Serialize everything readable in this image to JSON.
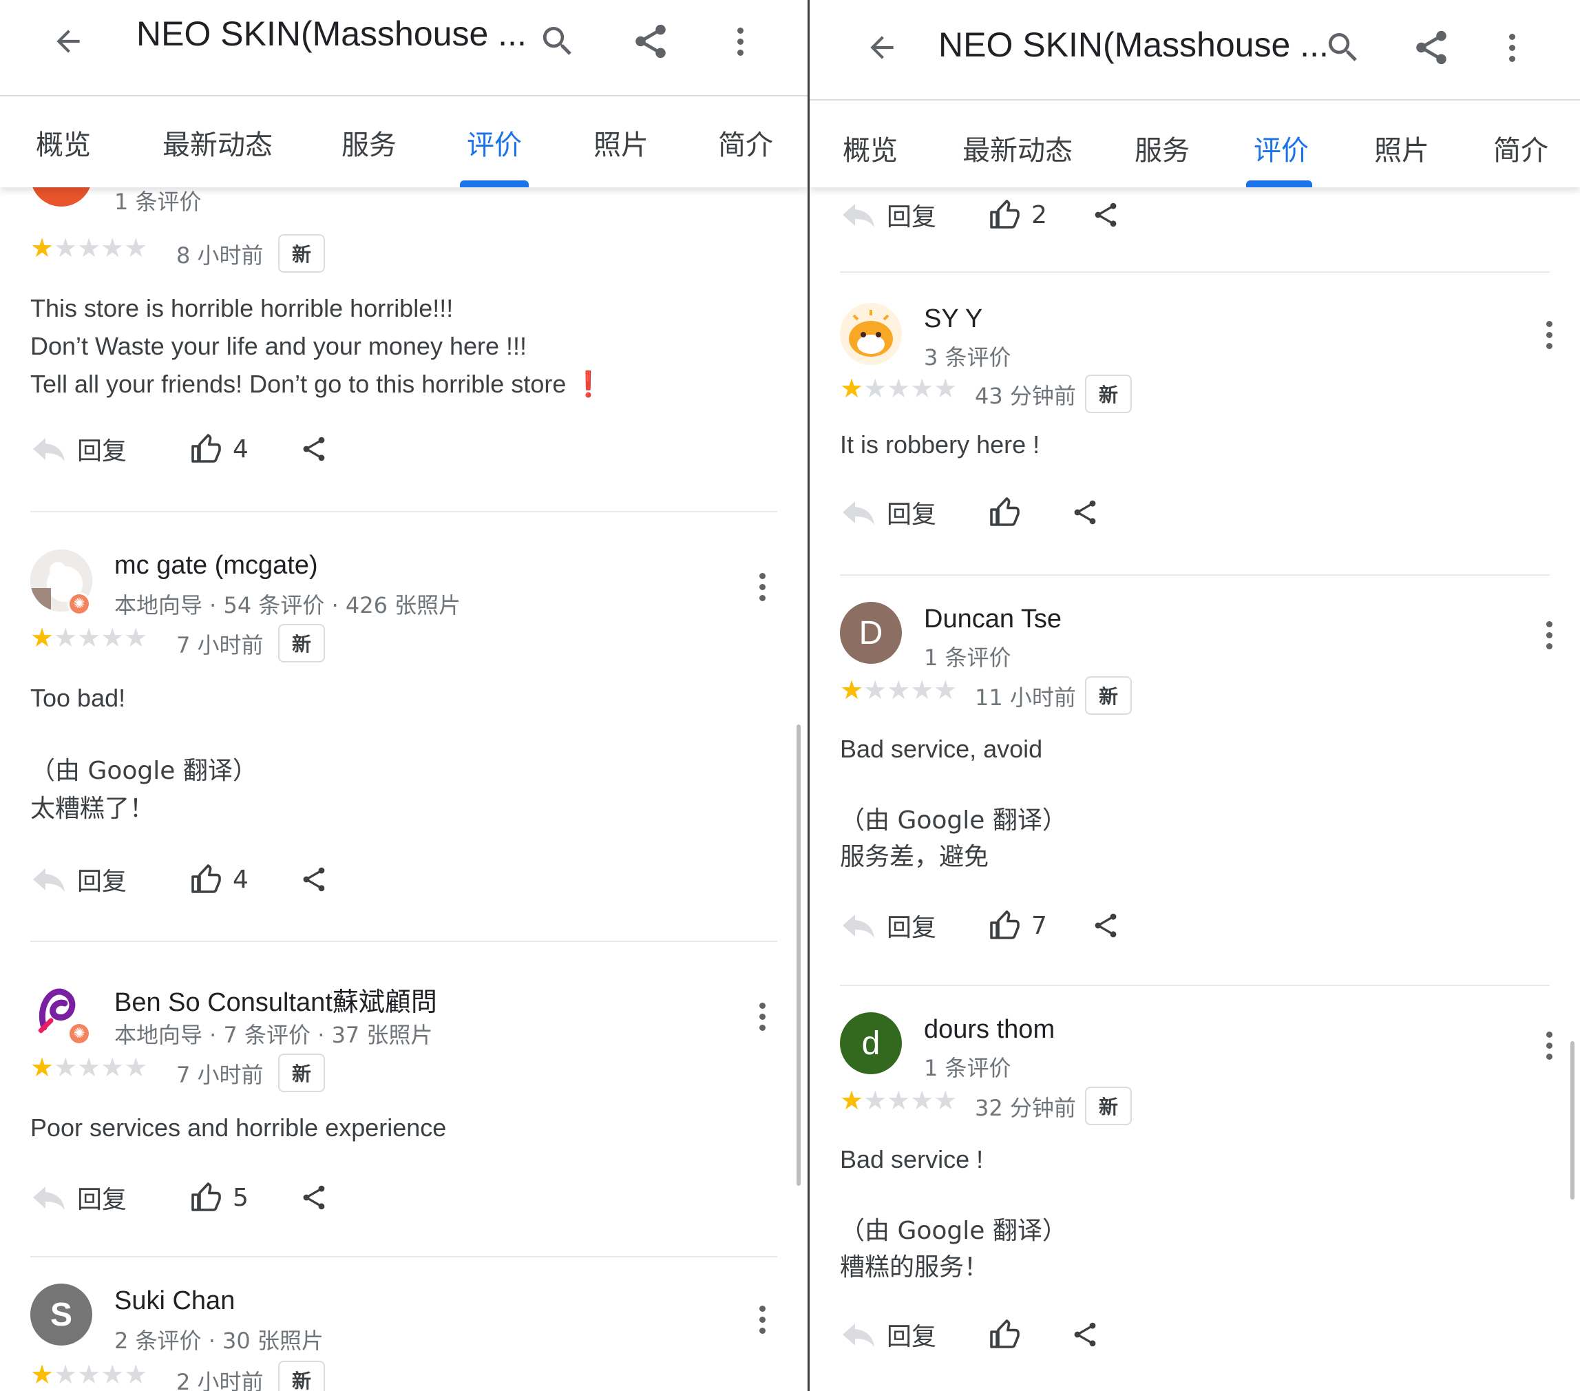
{
  "left": {
    "title": "NEO SKIN(Masshouse ...",
    "tabs": [
      "概览",
      "最新动态",
      "服务",
      "评价",
      "照片",
      "简介"
    ],
    "active_tab": "评价",
    "partial_review": {
      "meta": "1 条评价",
      "rating": 1,
      "time": "8 小时前",
      "badge": "新",
      "lines": [
        "This store is horrible horrible horrible!!!",
        "Don’t Waste your life and your money here !!!",
        "Tell all your friends! Don’t go to this horrible store"
      ],
      "exclamation": "❗",
      "reply": "回复",
      "likes": "4"
    },
    "reviews": [
      {
        "name": "mc gate (mcgate)",
        "meta": "本地向导 · 54 条评价 · 426 张照片",
        "rating": 1,
        "time": "7 小时前",
        "badge": "新",
        "text": "Too bad!",
        "translated_by": "（由 Google 翻译）",
        "translation": "太糟糕了！",
        "reply": "回复",
        "likes": "4"
      },
      {
        "name": "Ben So Consultant蘇斌顧問",
        "meta": "本地向导 · 7 条评价 · 37 张照片",
        "rating": 1,
        "time": "7 小时前",
        "badge": "新",
        "text": "Poor services and horrible experience",
        "reply": "回复",
        "likes": "5"
      },
      {
        "name": "Suki Chan",
        "meta": "2 条评价 · 30 张照片",
        "avatar_letter": "S",
        "avatar_color": "#757575",
        "rating": 1,
        "time": "2 小时前",
        "badge": "新"
      }
    ]
  },
  "right": {
    "title": "NEO SKIN(Masshouse ...",
    "tabs": [
      "概览",
      "最新动态",
      "服务",
      "评价",
      "照片",
      "简介"
    ],
    "active_tab": "评价",
    "top_actions": {
      "reply": "回复",
      "likes": "2"
    },
    "reviews": [
      {
        "name": "SY Y",
        "meta": "3 条评价",
        "rating": 1,
        "time": "43 分钟前",
        "badge": "新",
        "text": "It is robbery here !",
        "reply": "回复",
        "likes": ""
      },
      {
        "name": "Duncan Tse",
        "meta": "1 条评价",
        "avatar_letter": "D",
        "avatar_color": "#8d6e63",
        "rating": 1,
        "time": "11 小时前",
        "badge": "新",
        "text": "Bad service, avoid",
        "translated_by": "（由 Google 翻译）",
        "translation": "服务差，避免",
        "reply": "回复",
        "likes": "7"
      },
      {
        "name": "dours thom",
        "meta": "1 条评价",
        "avatar_letter": "d",
        "avatar_color": "#33691e",
        "rating": 1,
        "time": "32 分钟前",
        "badge": "新",
        "text": "Bad service !",
        "translated_by": "（由 Google 翻译）",
        "translation": "糟糕的服务！",
        "reply": "回复",
        "likes": ""
      }
    ]
  },
  "colors": {
    "accent": "#1a73e8",
    "star": "#fbbc04",
    "star_off": "#dadce0"
  },
  "icons": [
    "back-arrow-icon",
    "search-icon",
    "share-icon",
    "more-vert-icon",
    "reply-icon",
    "thumb-up-icon"
  ]
}
